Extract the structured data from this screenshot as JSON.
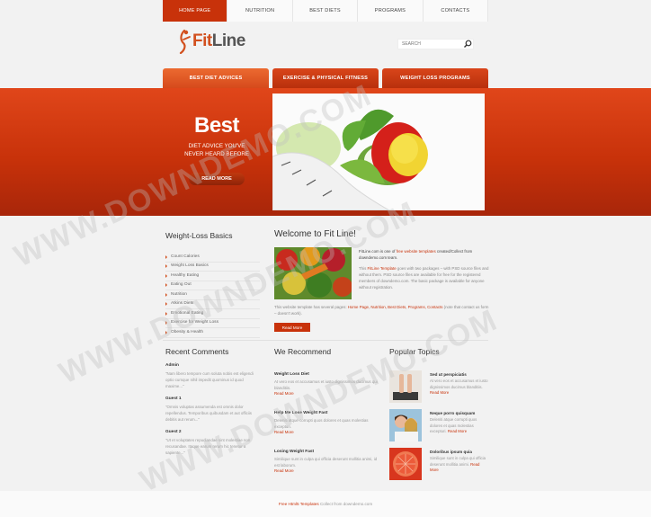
{
  "nav": {
    "items": [
      "HOME PAGE",
      "NUTRITION",
      "BEST DIETS",
      "PROGRAMS",
      "CONTACTS"
    ],
    "active_index": 0
  },
  "logo": {
    "prefix": "Fit",
    "suffix": "Line"
  },
  "search": {
    "placeholder": "SEARCH",
    "icon": "search-icon"
  },
  "tabs": {
    "items": [
      "BEST DIET ADVICES",
      "EXERCISE & PHYSICAL FITNESS",
      "WEIGHT LOSS PROGRAMS"
    ],
    "active_index": 0
  },
  "hero": {
    "headline": "Best",
    "line1": "DIET ADVICE YOU'VE",
    "line2": "NEVER HEARD BEFORE",
    "button": "READ MORE"
  },
  "weight_loss": {
    "title": "Weight-Loss Basics",
    "items": [
      "Count Calories",
      "Weight Loss Basics",
      "Healthy Eating",
      "Eating Out",
      "Nutrition",
      "Atkins Diets",
      "Emotional Eating",
      "Exercise for Weight Loss",
      "Obesity & Health"
    ]
  },
  "welcome": {
    "title": "Welcome to Fit Line!",
    "p1_a": "FitLine.com is one of ",
    "p1_link": "free website templates",
    "p1_b": " created/Collect from downdemo.com team.",
    "p2_a": "This ",
    "p2_link": "FitLine Template",
    "p2_b": " goes with two packages – with PSD source files and without them. PSD source files are available for free for the registered members of downdemo.com. The basic package is available for anyone without registration.",
    "p3_a": "This website template has several pages: ",
    "p3_links": "Home Page, Nutrition, Best Diets, Programs, Contacts",
    "p3_b": " (note that contact us form – doesn't work).",
    "read_more": "Read More"
  },
  "recent_comments": {
    "title": "Recent Comments",
    "entries": [
      {
        "author": "Admin",
        "text": "\"Nam libero tempore cum soluta nobis est eligendi optio cumque nihil impedit quominus id quod maxime...\""
      },
      {
        "author": "Guest 1",
        "text": "\"Omnis voluptas assumenda est omnis dolor repellendus. Temporibus quibusdam et aut officiis debitis aut rerum...\""
      },
      {
        "author": "Guest 2",
        "text": "\"Ut et voluptates repudiandae sint molestiae non recusandae. Itaque earum rerum hic tenetur a sapiente...\""
      }
    ]
  },
  "we_recommend": {
    "title": "We Recommend",
    "items": [
      {
        "heading": "Weight Loss Diet",
        "text": "At vero eos et accusamus et iusto dignissimos ducimus qui blanditiis.",
        "link": "Read More"
      },
      {
        "heading": "Help Me Lose Weight Fast",
        "text": "Deleniti atque corrupti quos dolores et quas molestias excepturi.",
        "link": "Read More"
      },
      {
        "heading": "Losing Weight Fast",
        "text": "Similique sunt in culpa qui officia deserunt mollitia animi, id est laborum.",
        "link": "Read More"
      }
    ]
  },
  "popular_topics": {
    "title": "Popular Topics",
    "items": [
      {
        "heading": "Sed ut perspiciatis",
        "text": "At vero eos et accusamus et iusto dignissimos ducimus blanditiis.",
        "link": "Read More"
      },
      {
        "heading": "Neque porro quisquam",
        "text": "Deleniti atque corrupti quos dolores et quas molestias excepturi.",
        "link": "Read More"
      },
      {
        "heading": "Doloribus ipsum quia",
        "text": "Similique sunt in culpa qui officia deserunt mollitia animi.",
        "link": "Read More"
      }
    ]
  },
  "footer": {
    "link": "Free Html5 Templates",
    "text": " Collect from downdemo.com"
  },
  "watermark": "WWW.DOWNDEMO.COM",
  "colors": {
    "accent": "#c8320a",
    "accent_light": "#e0461a",
    "background": "#f2f2f2"
  }
}
